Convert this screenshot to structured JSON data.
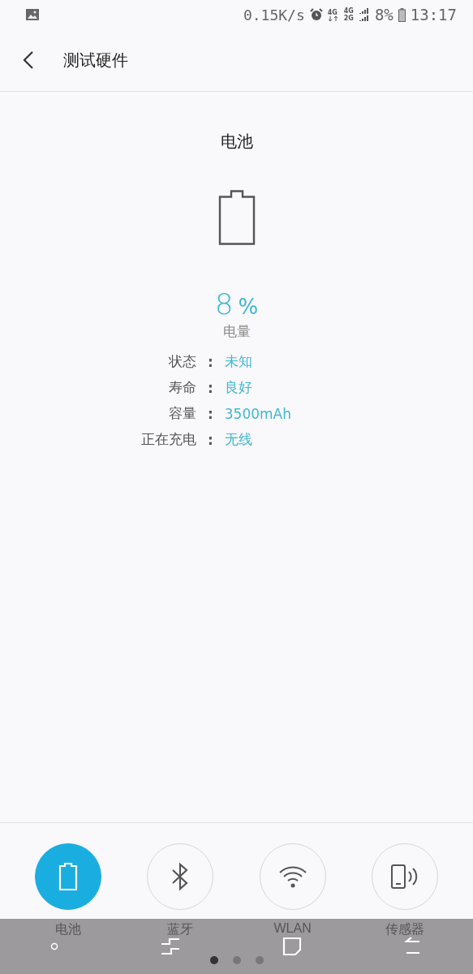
{
  "status_bar": {
    "net_speed": "0.15K/s",
    "network_top": "4G",
    "network_bottom": "2G",
    "network_left": "4G",
    "battery_percent": "8%",
    "time": "13:17"
  },
  "header": {
    "title": "测试硬件"
  },
  "battery": {
    "title": "电池",
    "percent": "8",
    "percent_sign": "%",
    "percent_label": "电量",
    "details": [
      {
        "label": "状态",
        "separator": ":",
        "value": "未知"
      },
      {
        "label": "寿命",
        "separator": ":",
        "value": "良好"
      },
      {
        "label": "容量",
        "separator": ":",
        "value": "3500mAh"
      },
      {
        "label": "正在充电",
        "separator": ":",
        "value": "无线"
      }
    ]
  },
  "tabs": [
    {
      "kind": "battery",
      "label": "电池",
      "selected": true
    },
    {
      "kind": "bluetooth",
      "label": "蓝牙",
      "selected": false
    },
    {
      "kind": "wifi",
      "label": "WLAN",
      "selected": false
    },
    {
      "kind": "sensor",
      "label": "传感器",
      "selected": false
    }
  ],
  "page_dots": [
    {
      "selected": true
    },
    {
      "selected": false
    },
    {
      "selected": false
    }
  ]
}
